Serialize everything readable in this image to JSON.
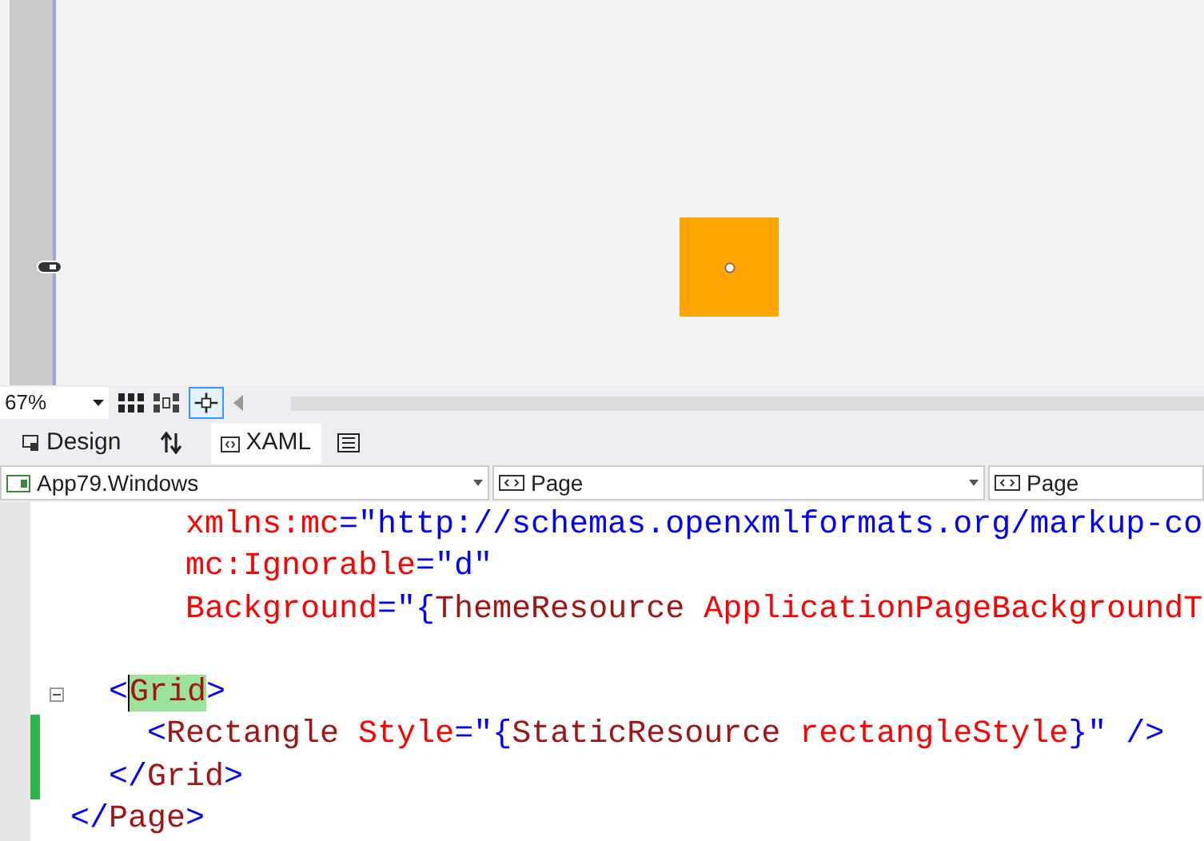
{
  "designer": {
    "zoom": "67%"
  },
  "tabs": [
    {
      "label": "Design",
      "selected": false,
      "kind": "design"
    },
    {
      "label": "XAML",
      "selected": true,
      "kind": "xaml"
    }
  ],
  "nav_bar": [
    "App79.Windows",
    "Page",
    "Page"
  ],
  "code_lines": [
    {
      "fold": false,
      "changed": false,
      "tokens": [
        {
          "kind": "attr",
          "text": "      xmlns:mc"
        },
        {
          "kind": "punct",
          "text": "=\"http://schemas.openxmlformats.org/markup-co"
        }
      ]
    },
    {
      "fold": false,
      "changed": false,
      "tokens": [
        {
          "kind": "attr",
          "text": "      mc:Ignorable"
        },
        {
          "kind": "punct",
          "text": "=\"d\""
        }
      ]
    },
    {
      "fold": false,
      "changed": false,
      "tokens": [
        {
          "kind": "attr",
          "text": "      Background"
        },
        {
          "kind": "punct",
          "text": "=\"{"
        },
        {
          "kind": "element",
          "text": "ThemeResource"
        },
        {
          "kind": "attr",
          "text": " ApplicationPageBackgroundT"
        }
      ]
    },
    {
      "fold": false,
      "changed": false
    },
    {
      "fold": true,
      "changed": false,
      "tokens": [
        {
          "kind": "punct",
          "text": "  <"
        },
        {
          "kind": "match",
          "text": "Grid"
        },
        {
          "kind": "punct",
          "text": ">"
        }
      ]
    },
    {
      "fold": false,
      "changed": true,
      "tokens": [
        {
          "kind": "punct",
          "text": "    <"
        },
        {
          "kind": "element",
          "text": "Rectangle"
        },
        {
          "kind": "attr",
          "text": " Style"
        },
        {
          "kind": "punct",
          "text": "=\"{"
        },
        {
          "kind": "element",
          "text": "StaticResource"
        },
        {
          "kind": "attr",
          "text": " rectangleStyle"
        },
        {
          "kind": "punct",
          "text": "}\" />"
        }
      ]
    },
    {
      "fold": false,
      "changed": true,
      "tokens": [
        {
          "kind": "punct",
          "text": "  </"
        },
        {
          "kind": "element",
          "text": "Grid"
        },
        {
          "kind": "punct",
          "text": ">"
        }
      ]
    },
    {
      "fold": false,
      "changed": false,
      "tokens": [
        {
          "kind": "punct",
          "text": "</"
        },
        {
          "kind": "element",
          "text": "Page"
        },
        {
          "kind": "punct",
          "text": ">"
        }
      ]
    }
  ]
}
